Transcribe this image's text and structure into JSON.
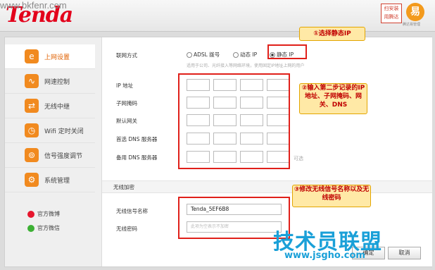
{
  "watermark": "www.bkfenr.com",
  "header": {
    "logo": "Tenda",
    "app_button": "扫安装 用腾达",
    "brand_mark": "易",
    "brand_caption": "腾达易管理"
  },
  "sidebar": {
    "items": [
      {
        "label": "上网设置",
        "icon": "ie-icon"
      },
      {
        "label": "网速控制",
        "icon": "speed-icon"
      },
      {
        "label": "无线中继",
        "icon": "relay-icon"
      },
      {
        "label": "Wifi 定时关闭",
        "icon": "clock-icon"
      },
      {
        "label": "信号强度调节",
        "icon": "signal-icon"
      },
      {
        "label": "系统管理",
        "icon": "gear-icon"
      }
    ],
    "weibo": "官方微博",
    "wechat": "官方微信"
  },
  "net": {
    "mode_label": "联网方式",
    "options": [
      "ADSL 拨号",
      "动态 IP",
      "静态 IP"
    ],
    "selected": "静态 IP",
    "hint": "适用于公司、光纤接入等网络环境，使用固定IP地址上网的用户",
    "fields": [
      "IP 地址",
      "子网掩码",
      "默认网关",
      "首选 DNS 服务器",
      "备用 DNS 服务器"
    ],
    "optional": "可选"
  },
  "wireless": {
    "section_title": "无线加密",
    "ssid_label": "无线信号名称",
    "ssid_value": "Tenda_5EF6B8",
    "pwd_label": "无线密码",
    "pwd_placeholder": "此项为空表示不加密"
  },
  "callouts": {
    "c1": "①选择静态IP",
    "c2": "②输入第二步记录的IP地址、子网掩码、网关、DNS",
    "c3": "③修改无线信号名称以及无线密码"
  },
  "buttons": {
    "confirm": "确定",
    "cancel": "取消"
  },
  "overlay_watermark": {
    "line1": "技术员联盟",
    "line2": "www.jsgho.com"
  },
  "colors": {
    "brand_red": "#e3001b",
    "accent_orange": "#f18a1f",
    "callout_text": "#c00000",
    "highlight": "#e0201a"
  }
}
